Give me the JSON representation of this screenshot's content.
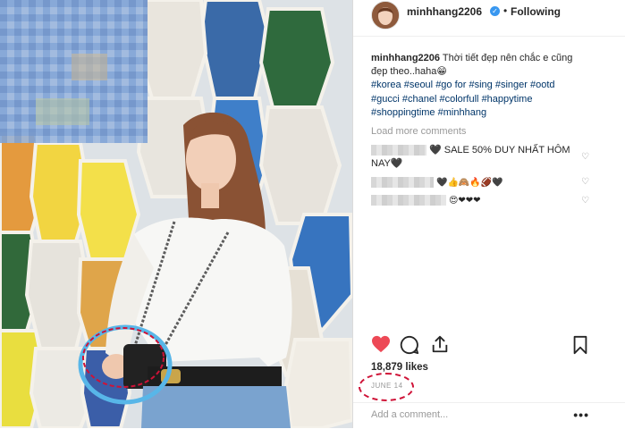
{
  "post": {
    "username": "minhhang2206",
    "separator": "•",
    "following_label": "Following",
    "caption_user": "minhhang2206",
    "caption_text": "Thời tiết đẹp nên chắc e cũng đẹp theo..haha😁",
    "hashtags": [
      "#korea",
      "#seoul",
      "#go for",
      "#sing",
      "#singer",
      "#ootd",
      "#gucci",
      "#chanel",
      "#colorfull",
      "#happytime",
      "#shoppingtime",
      "#minhhang"
    ],
    "load_more": "Load more comments",
    "comments": [
      {
        "text": "🖤 SALE 50% DUY NHẤT HÔM NAY🖤"
      },
      {
        "text": "🖤👍🙈🔥🏈🖤"
      },
      {
        "text": "😍❤❤❤"
      }
    ],
    "likes": "18,879 likes",
    "date": "JUNE 14",
    "add_comment_placeholder": "Add a comment...",
    "more_label": "•••"
  },
  "icons": {
    "verified": "verified-badge-icon",
    "like": "heart-filled-icon",
    "comment": "comment-bubble-icon",
    "share": "share-icon",
    "save": "bookmark-icon"
  },
  "colors": {
    "like_red": "#ed4956",
    "tag_blue": "#003569",
    "verified_blue": "#3897f0",
    "annotation_red": "#cf1237",
    "annotation_blue": "#58b6e8"
  }
}
